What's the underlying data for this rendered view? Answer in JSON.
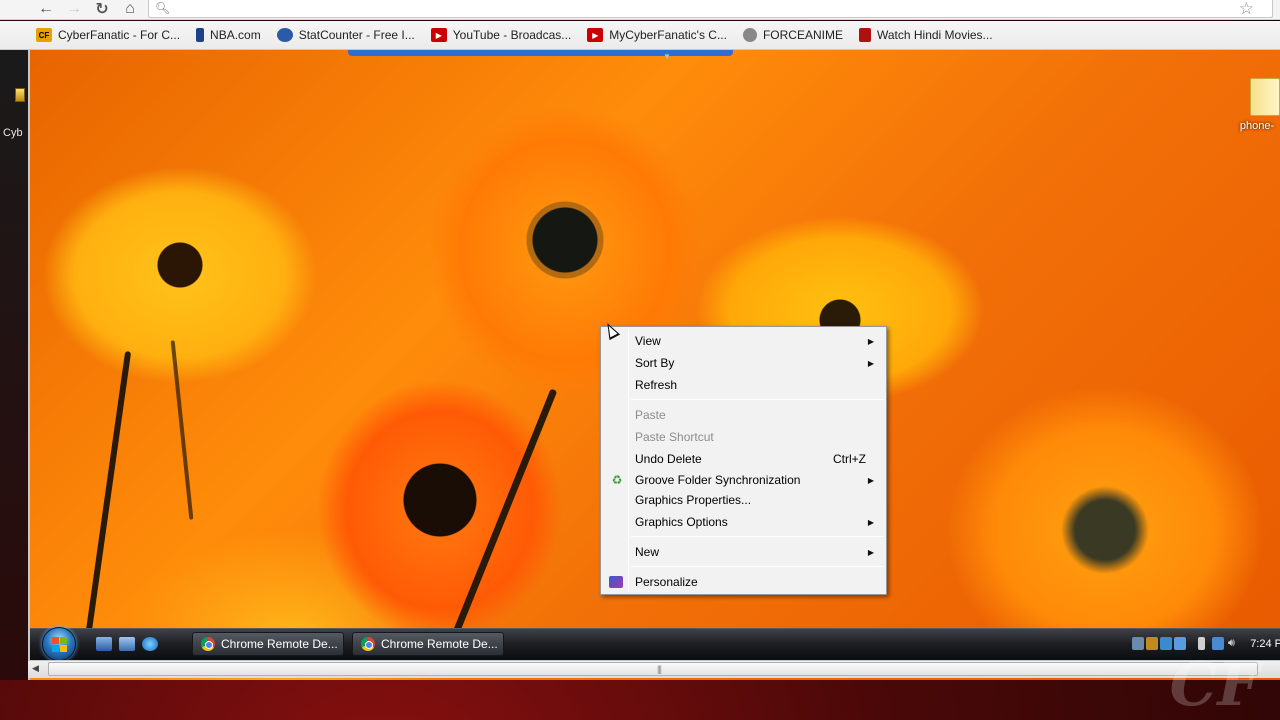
{
  "bookmarks": [
    {
      "label": "CyberFanatic - For C...",
      "icon": "cf-icon",
      "color": "#e6a000"
    },
    {
      "label": "NBA.com",
      "icon": "nba-icon",
      "color": "#c8102e"
    },
    {
      "label": "StatCounter - Free I...",
      "icon": "statcounter-icon",
      "color": "#2a5aa8"
    },
    {
      "label": "YouTube - Broadcas...",
      "icon": "youtube-icon",
      "color": "#cc0000"
    },
    {
      "label": "MyCyberFanatic's C...",
      "icon": "youtube-icon",
      "color": "#cc0000"
    },
    {
      "label": "FORCEANIME",
      "icon": "forceanime-icon",
      "color": "#777777"
    },
    {
      "label": "Watch Hindi Movies...",
      "icon": "hindi-movies-icon",
      "color": "#b01010"
    }
  ],
  "host": {
    "left_label": "Cyb"
  },
  "desktop": {
    "folder_label": "phone-"
  },
  "context_menu": {
    "items": [
      {
        "label": "View",
        "submenu": true
      },
      {
        "label": "Sort By",
        "submenu": true
      },
      {
        "label": "Refresh"
      },
      {
        "label": "Paste",
        "disabled": true
      },
      {
        "label": "Paste Shortcut",
        "disabled": true
      },
      {
        "label": "Undo Delete",
        "shortcut": "Ctrl+Z"
      },
      {
        "label": "Groove Folder Synchronization",
        "submenu": true,
        "icon": "groove-icon"
      },
      {
        "label": "Graphics Properties..."
      },
      {
        "label": "Graphics Options",
        "submenu": true
      },
      {
        "label": "New",
        "submenu": true
      },
      {
        "label": "Personalize",
        "icon": "personalize-icon"
      }
    ]
  },
  "taskbar": {
    "tasks": [
      {
        "label": "Chrome Remote De..."
      },
      {
        "label": "Chrome Remote De..."
      }
    ],
    "clock": "7:24 P"
  },
  "watermark": "CF"
}
